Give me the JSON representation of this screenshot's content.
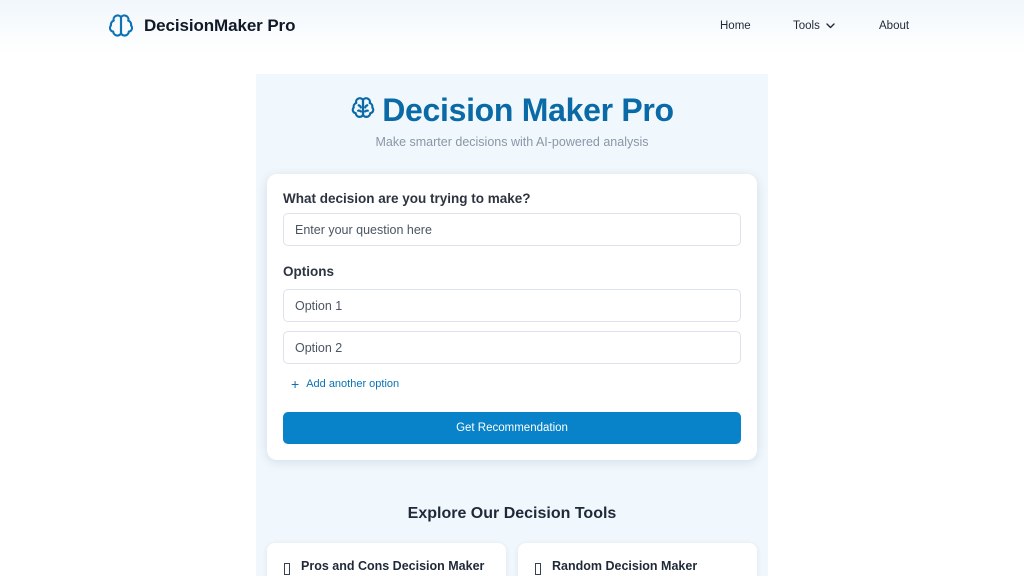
{
  "header": {
    "brand_name": "DecisionMaker Pro",
    "brand_icon": "brain-icon",
    "nav": {
      "home": "Home",
      "tools": "Tools",
      "about": "About"
    }
  },
  "hero": {
    "title": "Decision Maker Pro",
    "subtitle": "Make smarter decisions with AI-powered analysis"
  },
  "form": {
    "question_label": "What decision are you trying to make?",
    "question_placeholder": "Enter your question here",
    "options_label": "Options",
    "option_placeholders": [
      "Option 1",
      "Option 2"
    ],
    "add_option_label": "Add another option",
    "submit_label": "Get Recommendation"
  },
  "explore": {
    "title": "Explore Our Decision Tools",
    "tools": [
      {
        "title": "Pros and Cons Decision Maker"
      },
      {
        "title": "Random Decision Maker"
      }
    ]
  },
  "colors": {
    "accent": "#0a6aa6",
    "button": "#0882c8",
    "panel": "#f0f7fd"
  }
}
